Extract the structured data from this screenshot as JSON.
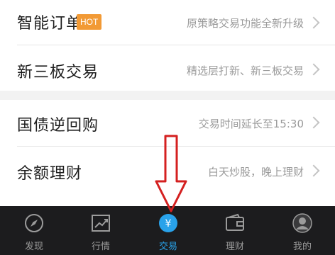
{
  "menu": {
    "items": [
      {
        "title": "智能订单",
        "badge": "HOT",
        "desc": "原策略交易功能全新升级"
      },
      {
        "title": "新三板交易",
        "desc": "精选层打新、新三板交易"
      },
      {
        "title": "国债逆回购",
        "desc": "交易时间延长至15:30"
      },
      {
        "title": "余额理财",
        "desc": "白天炒股，晚上理财"
      }
    ]
  },
  "tabbar": {
    "active": "交易",
    "tabs": [
      {
        "label": "发现",
        "icon": "compass-icon"
      },
      {
        "label": "行情",
        "icon": "chart-icon"
      },
      {
        "label": "交易",
        "icon": "yen-icon"
      },
      {
        "label": "理财",
        "icon": "wallet-icon"
      },
      {
        "label": "我的",
        "icon": "user-icon"
      }
    ]
  },
  "colors": {
    "accent": "#29a2ea",
    "hot_badge": "#f29a35",
    "arrow": "#d42020",
    "tabbar_bg": "#1c1c1e"
  }
}
